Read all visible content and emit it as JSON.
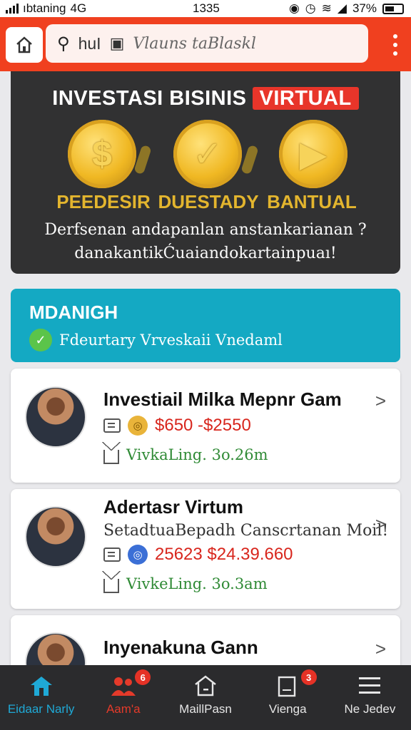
{
  "status_bar": {
    "carrier": "ıbtaning",
    "network": "4G",
    "time": "1335",
    "battery": "37%"
  },
  "browser": {
    "url_text": "huI",
    "placeholder": "Vlauns taBlaskl"
  },
  "hero": {
    "title": "INVESTASI BISINIS",
    "title_tag": "VIRTUAL",
    "features": [
      {
        "label": "PEEDESIR",
        "icon": "dollar-coin-icon",
        "glyph": "$"
      },
      {
        "label": "DUESTADY",
        "icon": "chart-coin-icon",
        "glyph": "✓"
      },
      {
        "label": "BANTUAL",
        "icon": "play-coin-icon",
        "glyph": "▶"
      }
    ],
    "desc_line1": "Derfsenan andapanlan anstankarianan ?",
    "desc_line2": "danakantikĆuaiandokartainpuaı!"
  },
  "banner": {
    "title": "MDANIGH",
    "subtitle": "Fdeurtary Vrveskaii Vnedaml"
  },
  "cards": [
    {
      "title": "Investiail Milka Mepnr Gam",
      "subtitle": "",
      "price": "$650 -$2550",
      "meta": "VivkaLing. 3o.26m"
    },
    {
      "title": "Adertasr Virtum",
      "subtitle": "SetadtuaBepadh Canscrtanan Moil!",
      "price": "25623 $24.39.660",
      "meta": "VivkeLing. 3o.3am"
    },
    {
      "title": "Inyenakuna Gann",
      "subtitle": "",
      "price": "",
      "meta": ""
    }
  ],
  "nav": [
    {
      "label": "Eidaar Narly",
      "badge": ""
    },
    {
      "label": "Aam'a",
      "badge": "6"
    },
    {
      "label": "MaillPasn",
      "badge": ""
    },
    {
      "label": "Vienga",
      "badge": "3"
    },
    {
      "label": "Ne Jedev",
      "badge": ""
    }
  ],
  "colors": {
    "browser_bar": "#f0401f",
    "hero_bg": "#313132",
    "banner_bg": "#14a9c3",
    "price": "#d8261d",
    "meta": "#2f8a35",
    "nav_active": "#1fa9d6"
  }
}
